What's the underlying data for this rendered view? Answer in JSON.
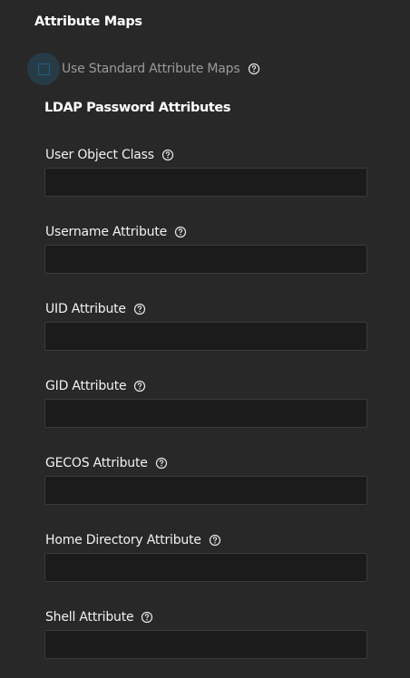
{
  "section": {
    "title": "Attribute Maps"
  },
  "standard_maps": {
    "label": "Use Standard Attribute Maps",
    "checked": false,
    "help_icon": "help-circle-icon"
  },
  "ldap": {
    "title": "LDAP Password Attributes",
    "fields": [
      {
        "label": "User Object Class",
        "value": "",
        "help_icon": "help-circle-icon"
      },
      {
        "label": "Username Attribute",
        "value": "",
        "help_icon": "help-circle-icon"
      },
      {
        "label": "UID Attribute",
        "value": "",
        "help_icon": "help-circle-icon"
      },
      {
        "label": "GID Attribute",
        "value": "",
        "help_icon": "help-circle-icon"
      },
      {
        "label": "GECOS Attribute",
        "value": "",
        "help_icon": "help-circle-icon"
      },
      {
        "label": "Home Directory Attribute",
        "value": "",
        "help_icon": "help-circle-icon"
      },
      {
        "label": "Shell Attribute",
        "value": "",
        "help_icon": "help-circle-icon"
      }
    ]
  },
  "colors": {
    "background": "#282828",
    "input_background": "#1b1b1b",
    "input_border": "#3a3a3a",
    "checkbox_border": "#1f5f88",
    "muted_text": "#9a9a9a"
  }
}
